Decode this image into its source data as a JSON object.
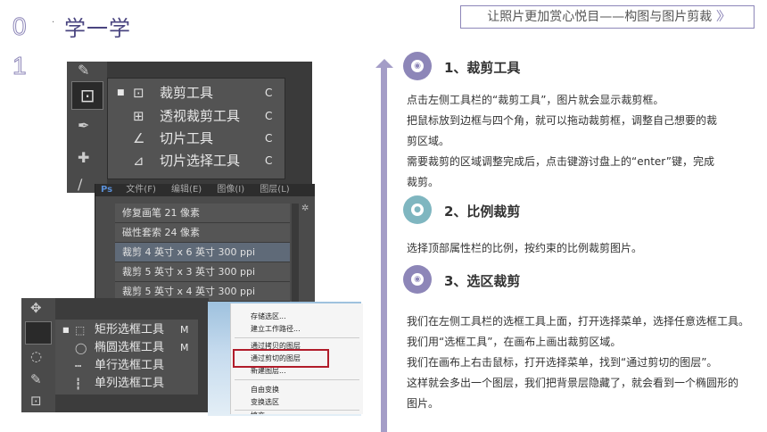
{
  "header": {
    "number_line1": "0",
    "number_line2": "1",
    "dot": "·",
    "title": "学一学",
    "banner_text": "让照片更加赏心悦目——构图与图片剪裁",
    "banner_chevrons": "〉〉"
  },
  "sections": [
    {
      "heading": "1、裁剪工具",
      "icon": "camera-icon",
      "lines": [
        "点击左侧工具栏的“裁剪工具”，图片就会显示裁剪框。",
        "把鼠标放到边框与四个角，就可以拖动裁剪框，调整自己想要的裁",
        "剪区域。",
        "需要裁剪的区域调整完成后，点击键游讨盘上的“enter”键，完成",
        "裁剪。"
      ]
    },
    {
      "heading": "2、比例裁剪",
      "icon": "chat-bubble-icon",
      "lines": [
        "选择顶部属性栏的比例，按约束的比例裁剪图片。"
      ]
    },
    {
      "heading": "3、选区裁剪",
      "icon": "camera-icon",
      "lines": [
        "我们在左侧工具栏的选框工具上面，打开选择菜单，选择任意选框工具。",
        "我们用“选框工具”，在画布上画出裁剪区域。",
        "我们在画布上右击鼠标，打开选择菜单，找到“通过剪切的图层”。",
        "这样就会多出一个图层，我们把背景层隐藏了，就会看到一个椭圆形的",
        "图片。"
      ]
    }
  ],
  "crop_flyout": [
    {
      "label": "裁剪工具",
      "key": "C",
      "icon": "crop-icon",
      "bullet": "■"
    },
    {
      "label": "透视裁剪工具",
      "key": "C",
      "icon": "perspective-crop-icon",
      "bullet": ""
    },
    {
      "label": "切片工具",
      "key": "C",
      "icon": "slice-icon",
      "bullet": ""
    },
    {
      "label": "切片选择工具",
      "key": "C",
      "icon": "slice-select-icon",
      "bullet": ""
    }
  ],
  "ps_menubar": [
    "Ps",
    "文件(F)",
    "编辑(E)",
    "图像(I)",
    "图层(L)"
  ],
  "presets": [
    "修复画笔 21 像素",
    "磁性套索 24 像素",
    "裁剪 4 英寸 x 6 英寸 300 ppi",
    "裁剪 5 英寸 x 3 英寸 300 ppi",
    "裁剪 5 英寸 x 4 英寸 300 ppi"
  ],
  "marquee_flyout": [
    {
      "label": "矩形选框工具",
      "key": "M",
      "icon": "rect-marquee-icon",
      "bullet": "■"
    },
    {
      "label": "椭圆选框工具",
      "key": "M",
      "icon": "ellipse-marquee-icon",
      "bullet": ""
    },
    {
      "label": "单行选框工具",
      "key": "",
      "icon": "row-marquee-icon",
      "bullet": ""
    },
    {
      "label": "单列选框工具",
      "key": "",
      "icon": "column-marquee-icon",
      "bullet": ""
    }
  ],
  "context_menu": [
    "存储选区...",
    "建立工作路径...",
    "通过拷贝的图层",
    "通过剪切的图层",
    "新建图层...",
    "自由变换",
    "变换选区",
    "填充..."
  ],
  "colors": {
    "accent": "#8d86b8",
    "accent_teal": "#7fb6c0",
    "highlight_box": "#b11c2a"
  }
}
